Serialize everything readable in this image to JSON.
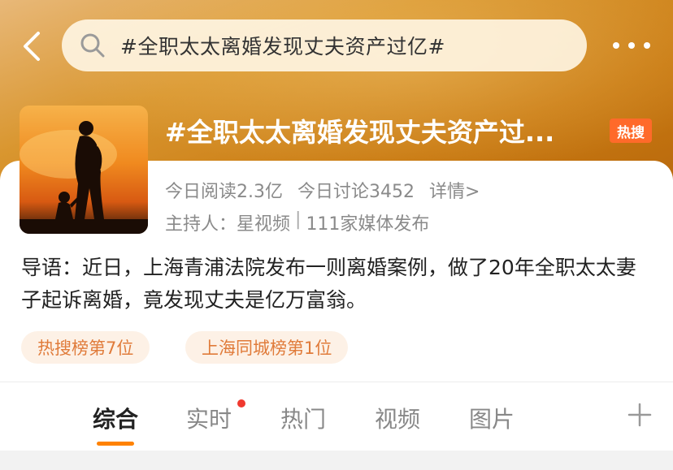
{
  "search": {
    "query": "#全职太太离婚发现丈夫资产过亿#"
  },
  "topic": {
    "title": "#全职太太离婚发现丈夫资产过...",
    "badge": "热搜",
    "reads": "今日阅读2.3亿",
    "discussions": "今日讨论3452",
    "detail_link": "详情>",
    "host": "主持人：星视频",
    "media": "111家媒体发布",
    "intro": "导语：近日，上海青浦法院发布一则离婚案例，做了20年全职太太妻子起诉离婚，竟发现丈夫是亿万富翁。"
  },
  "tags": [
    "热搜榜第7位",
    "上海同城榜第1位"
  ],
  "tabs": [
    {
      "label": "综合",
      "active": true
    },
    {
      "label": "实时",
      "has_dot": true
    },
    {
      "label": "热门"
    },
    {
      "label": "视频"
    },
    {
      "label": "图片"
    }
  ],
  "colors": {
    "accent": "#ff8200",
    "badge": "#ff6a2a",
    "tag_text": "#e07b3a",
    "dot": "#f0392f"
  },
  "icons": {
    "back": "chevron-left-icon",
    "search": "search-icon",
    "more": "more-dots-icon",
    "add": "plus-icon"
  }
}
